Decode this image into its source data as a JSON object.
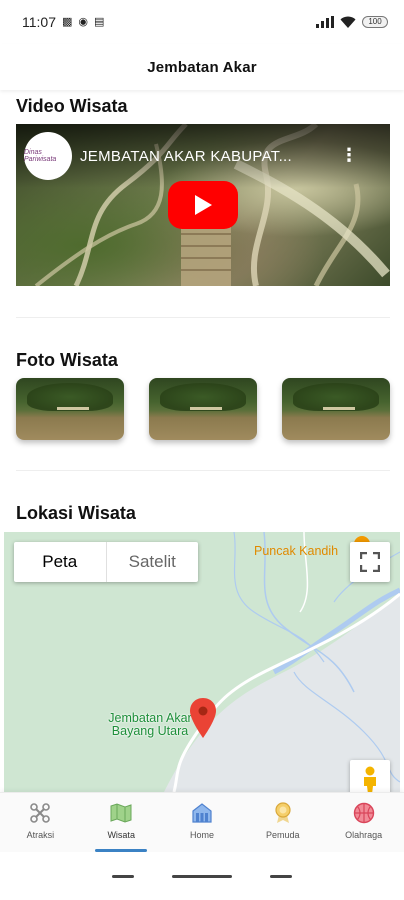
{
  "status_bar": {
    "time": "11:07",
    "battery": "100"
  },
  "app_bar": {
    "title": "Jembatan Akar"
  },
  "video_section": {
    "title": "Video Wisata",
    "video_title": "JEMBATAN AKAR KABUPAT...",
    "channel_logo_text": "Dinas Pariwisata"
  },
  "photo_section": {
    "title": "Foto Wisata",
    "photo_count": 3
  },
  "location_section": {
    "title": "Lokasi Wisata",
    "map_type": {
      "active": "Peta",
      "inactive": "Satelit"
    },
    "poi_label": "Puncak Kandih",
    "marker_label_line1": "Jembatan Akar",
    "marker_label_line2": "Bayang Utara"
  },
  "bottom_nav": {
    "items": [
      {
        "label": "Atraksi",
        "icon": "drone-icon",
        "color": "#8a8a8a"
      },
      {
        "label": "Wisata",
        "icon": "map-icon",
        "color": "#7fbf6a"
      },
      {
        "label": "Home",
        "icon": "building-icon",
        "color": "#5b8fd8"
      },
      {
        "label": "Pemuda",
        "icon": "award-icon",
        "color": "#e8c46a"
      },
      {
        "label": "Olahraga",
        "icon": "basketball-icon",
        "color": "#e85a6a"
      }
    ],
    "active_index": 1
  },
  "colors": {
    "accent": "#3b82c4",
    "play_button": "#ff0000",
    "map_water": "#aecbf0",
    "map_land": "#cfe6d2"
  }
}
